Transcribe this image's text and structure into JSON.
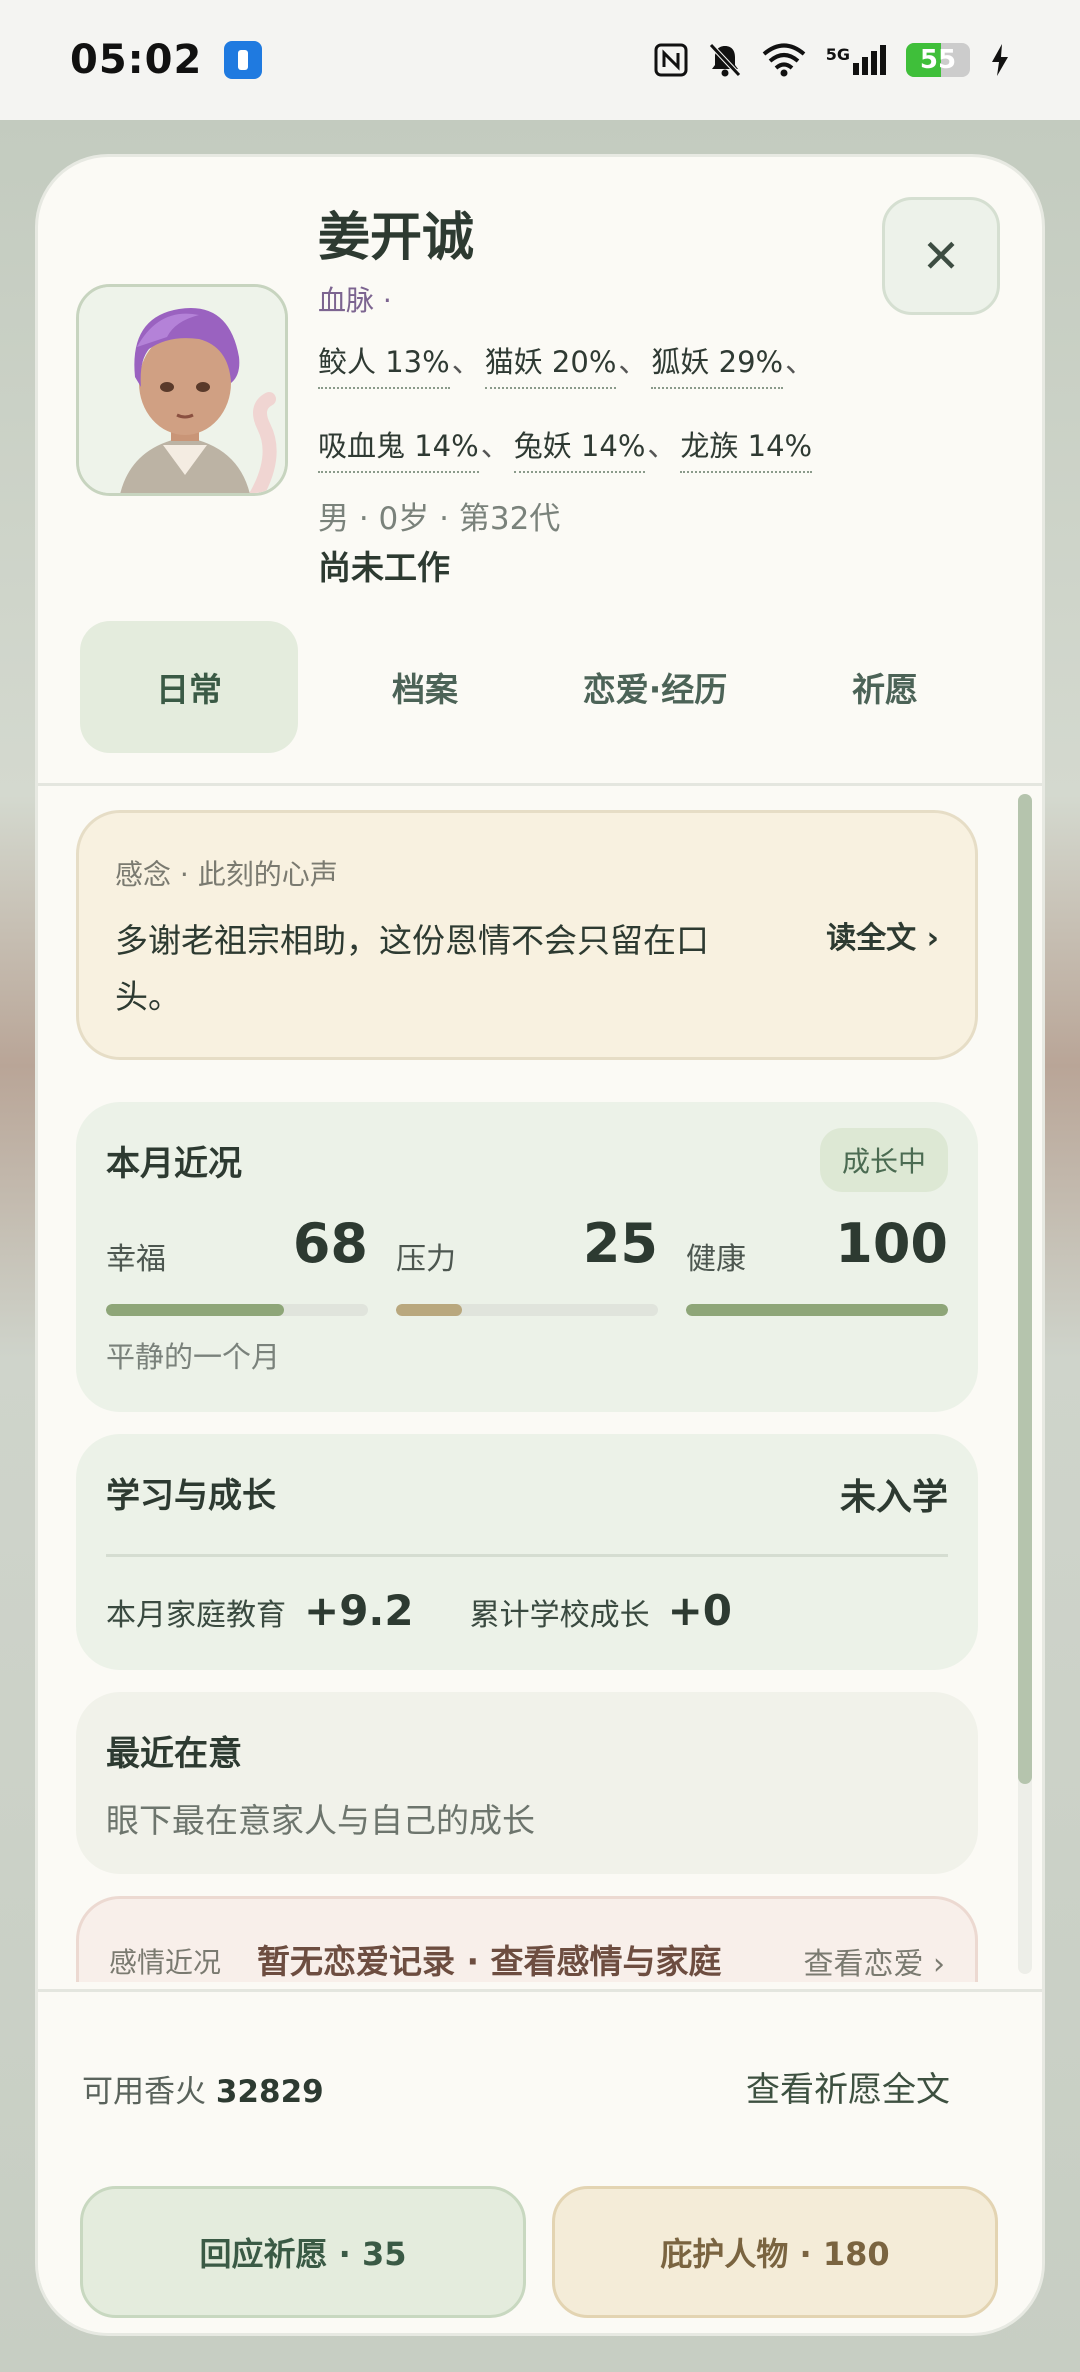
{
  "status_bar": {
    "time": "05:02",
    "icons": [
      "flashlight-app-icon",
      "nfc-icon",
      "bell-off-icon",
      "wifi-icon",
      "5g-signal-icon",
      "battery-icon",
      "charging-icon"
    ],
    "network": "5G",
    "battery_level": "55",
    "battery_fraction": 0.55
  },
  "profile": {
    "name": "姜开诚",
    "bloodline_label": "血脉 ·",
    "bloodlines_row1": [
      "鲛人 13%",
      "猫妖 20%",
      "狐妖 29%"
    ],
    "bloodlines_row2": [
      "吸血鬼 14%",
      "兔妖 14%",
      "龙族 14%"
    ],
    "separator": "、",
    "meta": "男 · 0岁 · 第32代",
    "job": "尚未工作"
  },
  "close_label": "✕",
  "tabs": [
    "日常",
    "档案",
    "恋爱·经历",
    "祈愿"
  ],
  "active_tab": "日常",
  "voice": {
    "label": "感念 · 此刻的心声",
    "text": "多谢老祖宗相助，这份恩情不会只留在口头。",
    "read_all": "读全文 ›"
  },
  "month": {
    "title": "本月近况",
    "badge": "成长中",
    "stats": [
      {
        "label": "幸福",
        "value": "68",
        "level": 0.68,
        "color": "#8ea678"
      },
      {
        "label": "压力",
        "value": "25",
        "level": 0.25,
        "color": "#b9a87e"
      },
      {
        "label": "健康",
        "value": "100",
        "level": 1.0,
        "color": "#8ea678"
      }
    ],
    "note": "平静的一个月"
  },
  "study": {
    "title": "学习与成长",
    "status": "未入学",
    "family_label": "本月家庭教育",
    "family_value": "+9.2",
    "school_label": "累计学校成长",
    "school_value": "+0"
  },
  "recent": {
    "title": "最近在意",
    "text": "眼下最在意家人与自己的成长"
  },
  "love": {
    "label": "感情近况",
    "text": "暂无恋爱记录 · 查看感情与家庭",
    "link": "查看恋爱 ›"
  },
  "footer": {
    "incense_label": "可用香火",
    "incense_value": "32829",
    "view_full": "查看祈愿全文",
    "answer_button": "回应祈愿 · 35",
    "protect_button": "庇护人物 · 180"
  }
}
